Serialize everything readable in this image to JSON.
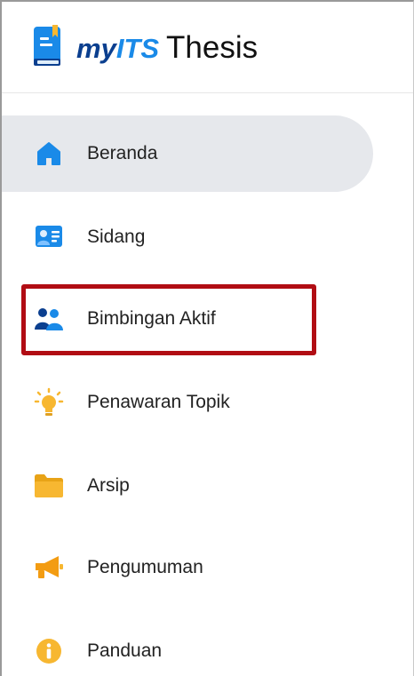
{
  "app": {
    "brand_my": "my",
    "brand_its": "ITS",
    "brand_thesis": "Thesis"
  },
  "nav": {
    "items": [
      {
        "label": "Beranda",
        "icon": "home-icon",
        "active": true
      },
      {
        "label": "Sidang",
        "icon": "id-card-icon",
        "active": false
      },
      {
        "label": "Bimbingan Aktif",
        "icon": "users-icon",
        "active": false,
        "highlighted": true
      },
      {
        "label": "Penawaran Topik",
        "icon": "lightbulb-icon",
        "active": false
      },
      {
        "label": "Arsip",
        "icon": "folder-icon",
        "active": false
      },
      {
        "label": "Pengumuman",
        "icon": "megaphone-icon",
        "active": false
      },
      {
        "label": "Panduan",
        "icon": "info-icon",
        "active": false
      }
    ]
  },
  "colors": {
    "brand_dark": "#0b3f8f",
    "brand_light": "#1a8ae8",
    "active_bg": "#e6e8ec",
    "highlight_border": "#b10d14",
    "icon_yellow": "#f7b731",
    "icon_orange": "#f39c12"
  }
}
